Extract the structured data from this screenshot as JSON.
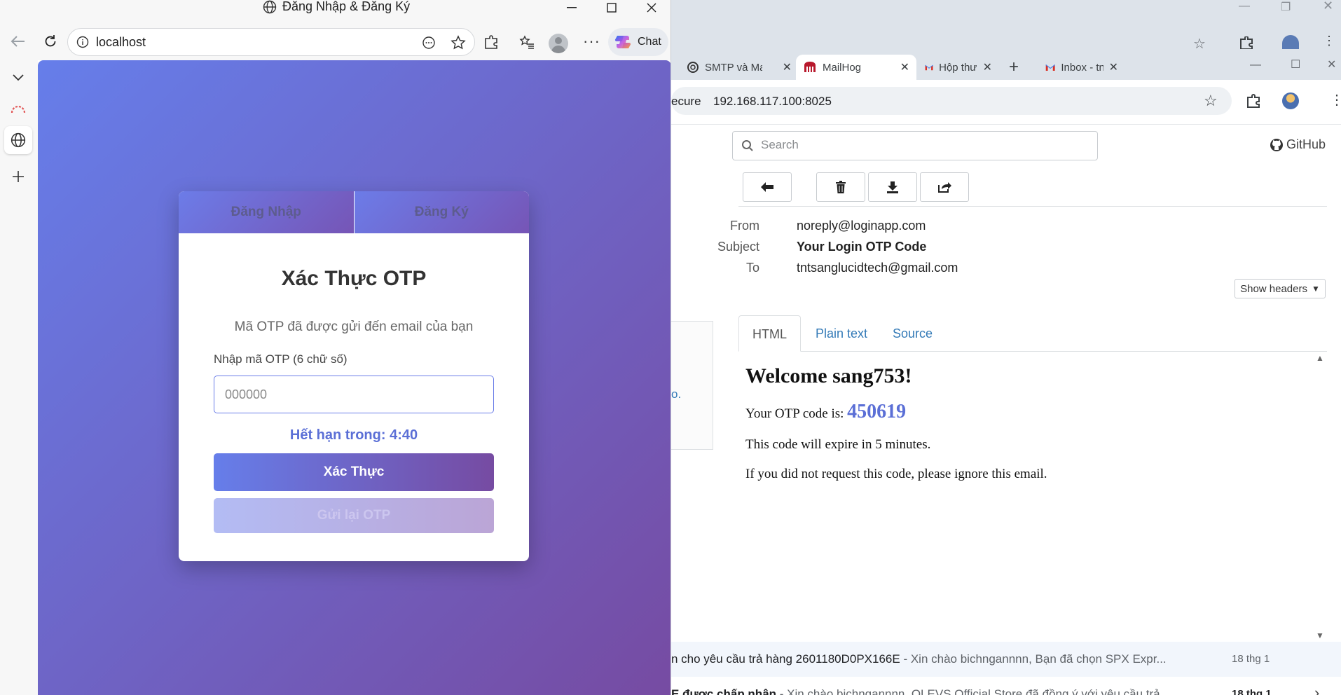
{
  "edge": {
    "window_title": "Đăng Nhập & Đăng Ký",
    "address": "localhost",
    "copilot_label": "Chat",
    "card": {
      "tab_login": "Đăng Nhập",
      "tab_register": "Đăng Ký",
      "title": "Xác Thực OTP",
      "subtitle": "Mã OTP đã được gửi đến email của bạn",
      "input_label": "Nhập mã OTP (6 chữ số)",
      "input_placeholder": "000000",
      "timer": "Hết hạn trong: 4:40",
      "verify_button": "Xác Thực",
      "resend_button": "Gửi lại OTP"
    }
  },
  "chrome": {
    "tabs": [
      {
        "label": "SMTP và Ma",
        "icon": "openai-icon"
      },
      {
        "label": "MailHog",
        "icon": "mailhog-icon",
        "active": true
      },
      {
        "label": "Hộp thư đến",
        "icon": "gmail-icon"
      },
      {
        "label": "Inbox - tntsa",
        "icon": "gmail-icon"
      }
    ],
    "url_prefix": "ecure",
    "url": "192.168.117.100:8025"
  },
  "mailhog": {
    "search_placeholder": "Search",
    "github_label": "GitHub",
    "headers": {
      "from_label": "From",
      "from": "noreply@loginapp.com",
      "subject_label": "Subject",
      "subject": "Your Login OTP Code",
      "to_label": "To",
      "to": "tntsanglucidtech@gmail.com"
    },
    "show_headers": "Show headers",
    "tabs": [
      "HTML",
      "Plain text",
      "Source"
    ],
    "email": {
      "greeting": "Welcome sang753!",
      "otp_prefix": "Your OTP code is: ",
      "otp_code": "450619",
      "expire_line": "This code will expire in 5 minutes.",
      "ignore_line": "If you did not request this code, please ignore this email."
    },
    "peek_text": "o."
  },
  "gmail_rows": [
    {
      "subject": "n cho yêu cầu trả hàng 2601180D0PX166E",
      "snippet": " - Xin chào bichngannnn, Bạn đã chọn SPX Expr...",
      "date": "18 thg 1",
      "bold": false
    },
    {
      "subject": "E được chấp nhận",
      "snippet": " - Xin chào bichngannnn, OLEVS Official Store đã đồng ý với yêu cầu trả...",
      "date": "18 thg 1",
      "bold": true
    }
  ],
  "colors": {
    "gradient_start": "#667eea",
    "gradient_end": "#764ba2",
    "link_blue": "#337ab7",
    "otp_color": "#5b6fd6"
  }
}
